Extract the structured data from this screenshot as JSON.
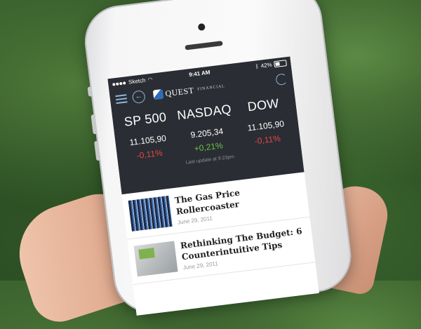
{
  "status_bar": {
    "carrier": "Sketch",
    "time": "9:41 AM",
    "battery": "42%"
  },
  "app": {
    "logo_text": "QUEST",
    "logo_sub": "FINANCIAL"
  },
  "markets": [
    {
      "name": "SP 500",
      "value": "11.105,90",
      "change": "-0,11%",
      "direction": "down"
    },
    {
      "name": "NASDAQ",
      "value": "9.205,34",
      "change": "+0,21%",
      "direction": "up"
    },
    {
      "name": "DOW",
      "value": "11.105,90",
      "change": "-0,11%",
      "direction": "down"
    }
  ],
  "last_update": "Last update at 9:23pm",
  "articles": [
    {
      "title": "The Gas Price Rollercoaster",
      "date": "June 29, 2011"
    },
    {
      "title": "Rethinking The Budget: 6 Counterintuitive Tips",
      "date": "June 29, 2011"
    }
  ],
  "colors": {
    "header_bg": "#2a2d33",
    "icon_accent": "#8fb6e0",
    "negative": "#e2484a",
    "positive": "#6cc24a"
  }
}
